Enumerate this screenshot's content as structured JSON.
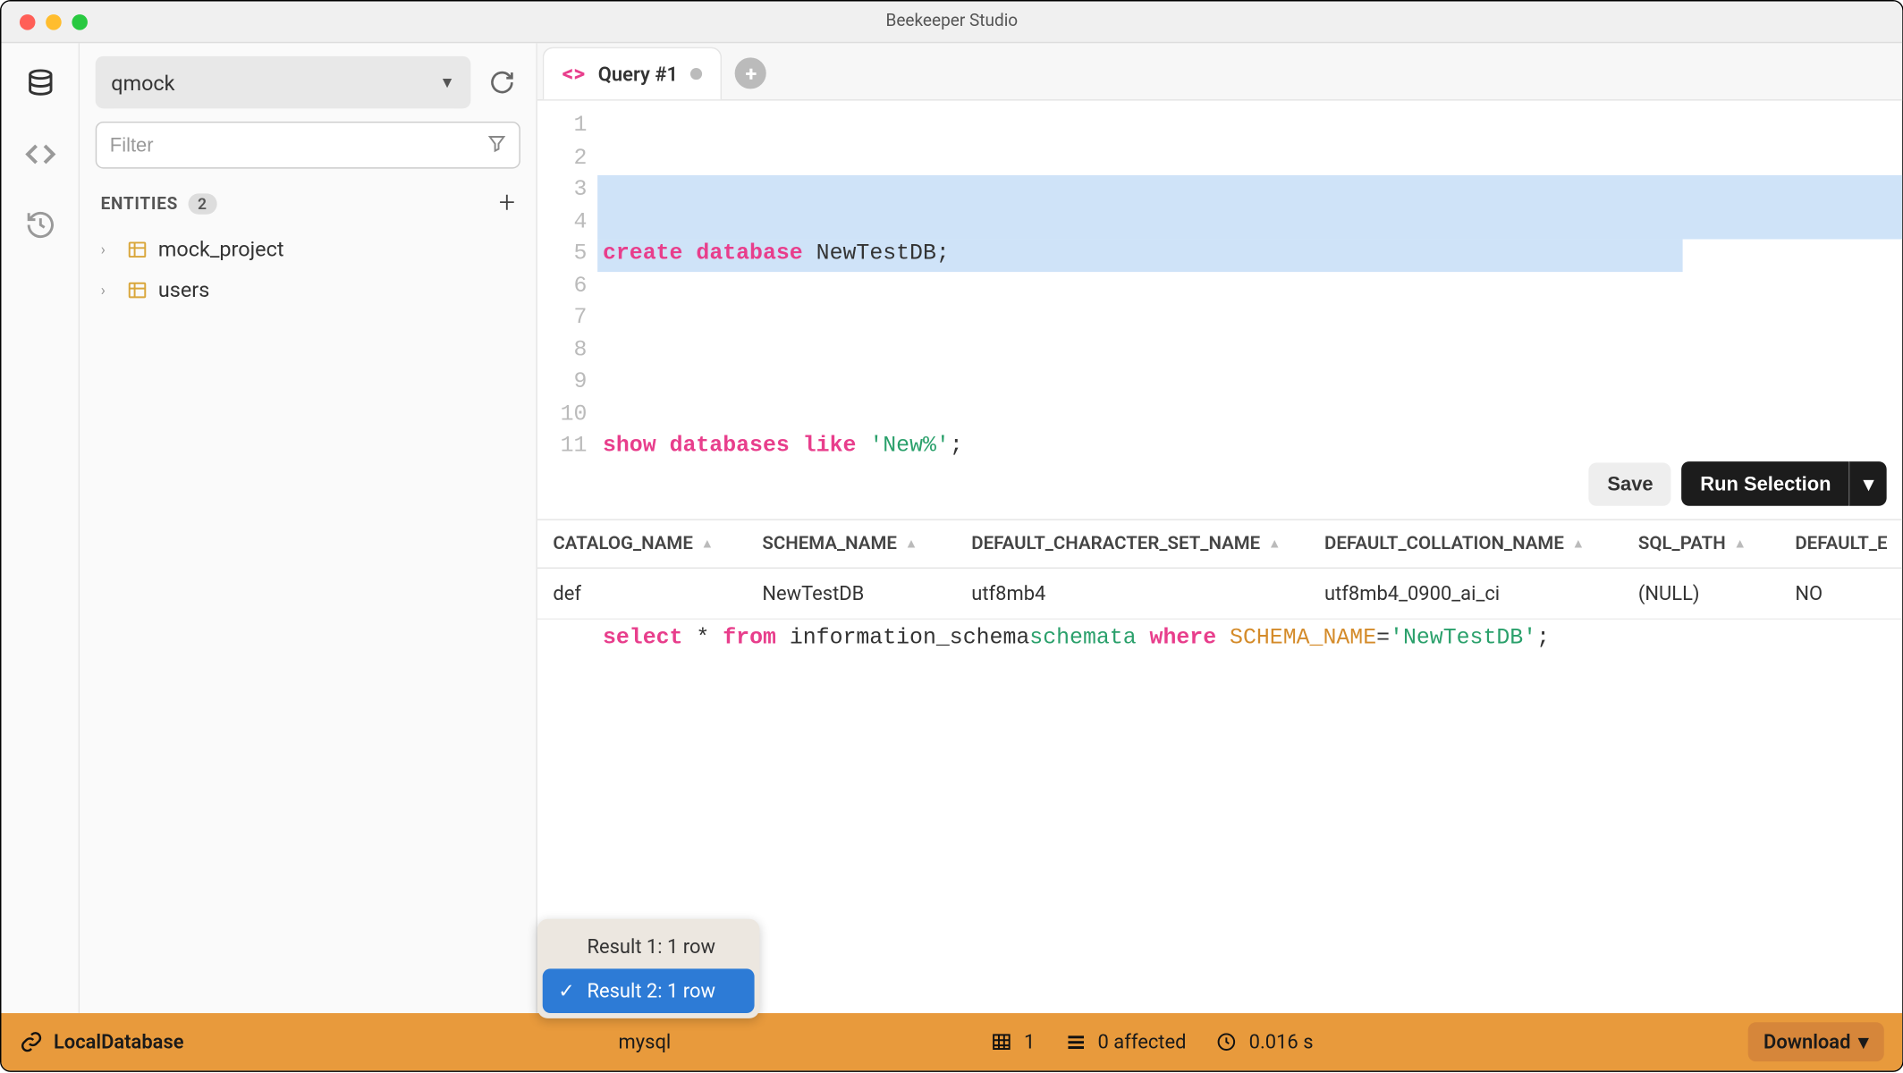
{
  "app_title": "Beekeeper Studio",
  "sidebar": {
    "selected_db": "qmock",
    "filter_placeholder": "Filter",
    "entities_label": "ENTITIES",
    "entities_count": "2",
    "items": [
      {
        "name": "mock_project"
      },
      {
        "name": "users"
      }
    ]
  },
  "tab": {
    "label": "Query #1"
  },
  "editor": {
    "lines": [
      "1",
      "2",
      "3",
      "4",
      "5",
      "6",
      "7",
      "8",
      "9",
      "10",
      "11"
    ],
    "l1": {
      "kw1": "create",
      "kw2": "database",
      "id": "NewTestDB",
      ";": ";"
    },
    "l3": {
      "kw1": "show",
      "kw2": "databases",
      "kw3": "like",
      "str": "'New%'",
      ";": ";"
    },
    "l5": {
      "kw1": "select",
      "star": "*",
      "kw2": "from",
      "ns": "information_schema",
      ".": ".",
      "tbl": "schemata",
      "kw3": "where",
      "col": "SCHEMA_NAME",
      "eq": "=",
      "str": "'NewTestDB'",
      ";": ";"
    }
  },
  "buttons": {
    "save": "Save",
    "run": "Run Selection"
  },
  "results": {
    "columns": [
      "CATALOG_NAME",
      "SCHEMA_NAME",
      "DEFAULT_CHARACTER_SET_NAME",
      "DEFAULT_COLLATION_NAME",
      "SQL_PATH",
      "DEFAULT_E"
    ],
    "row": {
      "catalog": "def",
      "schema": "NewTestDB",
      "charset": "utf8mb4",
      "collation": "utf8mb4_0900_ai_ci",
      "sqlpath": "(NULL)",
      "def_e": "NO"
    }
  },
  "footer": {
    "connection": "LocalDatabase",
    "dbtype": "mysql",
    "rowcount": "1",
    "affected": "0 affected",
    "elapsed": "0.016 s",
    "download": "Download"
  },
  "popup": {
    "items": [
      {
        "label": "Result 1: 1 row",
        "active": false
      },
      {
        "label": "Result 2: 1 row",
        "active": true
      }
    ]
  }
}
